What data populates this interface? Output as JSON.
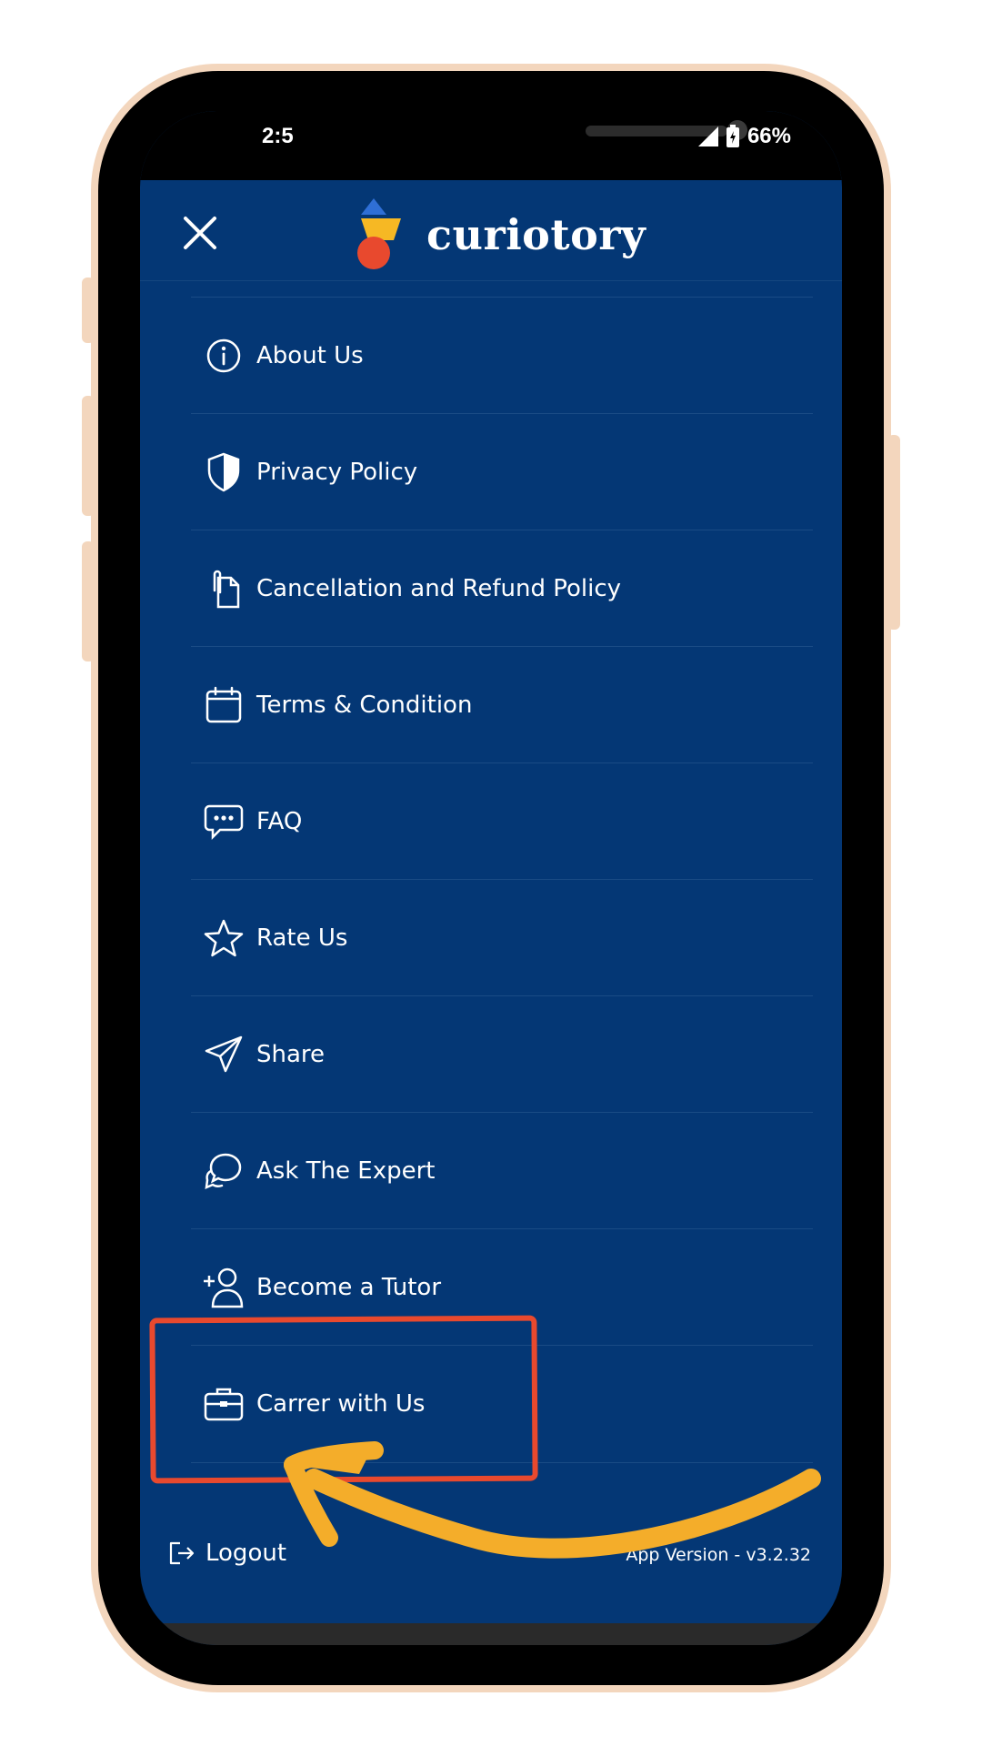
{
  "status_bar": {
    "time": "2:5",
    "battery": "66%"
  },
  "header": {
    "logo_text": "curiotory",
    "close_icon": "close-icon"
  },
  "menu": {
    "items": [
      {
        "label": "About Us",
        "icon": "info-icon"
      },
      {
        "label": "Privacy Policy",
        "icon": "shield-icon"
      },
      {
        "label": "Cancellation and Refund Policy",
        "icon": "document-icon"
      },
      {
        "label": "Terms & Condition",
        "icon": "calendar-icon"
      },
      {
        "label": "FAQ",
        "icon": "chat-bubble-icon"
      },
      {
        "label": "Rate Us",
        "icon": "star-icon"
      },
      {
        "label": "Share",
        "icon": "send-icon"
      },
      {
        "label": "Ask The Expert",
        "icon": "chat-icon"
      },
      {
        "label": "Become a Tutor",
        "icon": "add-user-icon"
      },
      {
        "label": "Carrer with Us",
        "icon": "briefcase-icon"
      }
    ]
  },
  "footer": {
    "logout_label": "Logout",
    "app_version": "App Version - v3.2.32"
  },
  "colors": {
    "background": "#043775",
    "highlight_box": "#e8492e",
    "arrow": "#f4ad2a",
    "phone_frame": "#f3d6bd"
  }
}
